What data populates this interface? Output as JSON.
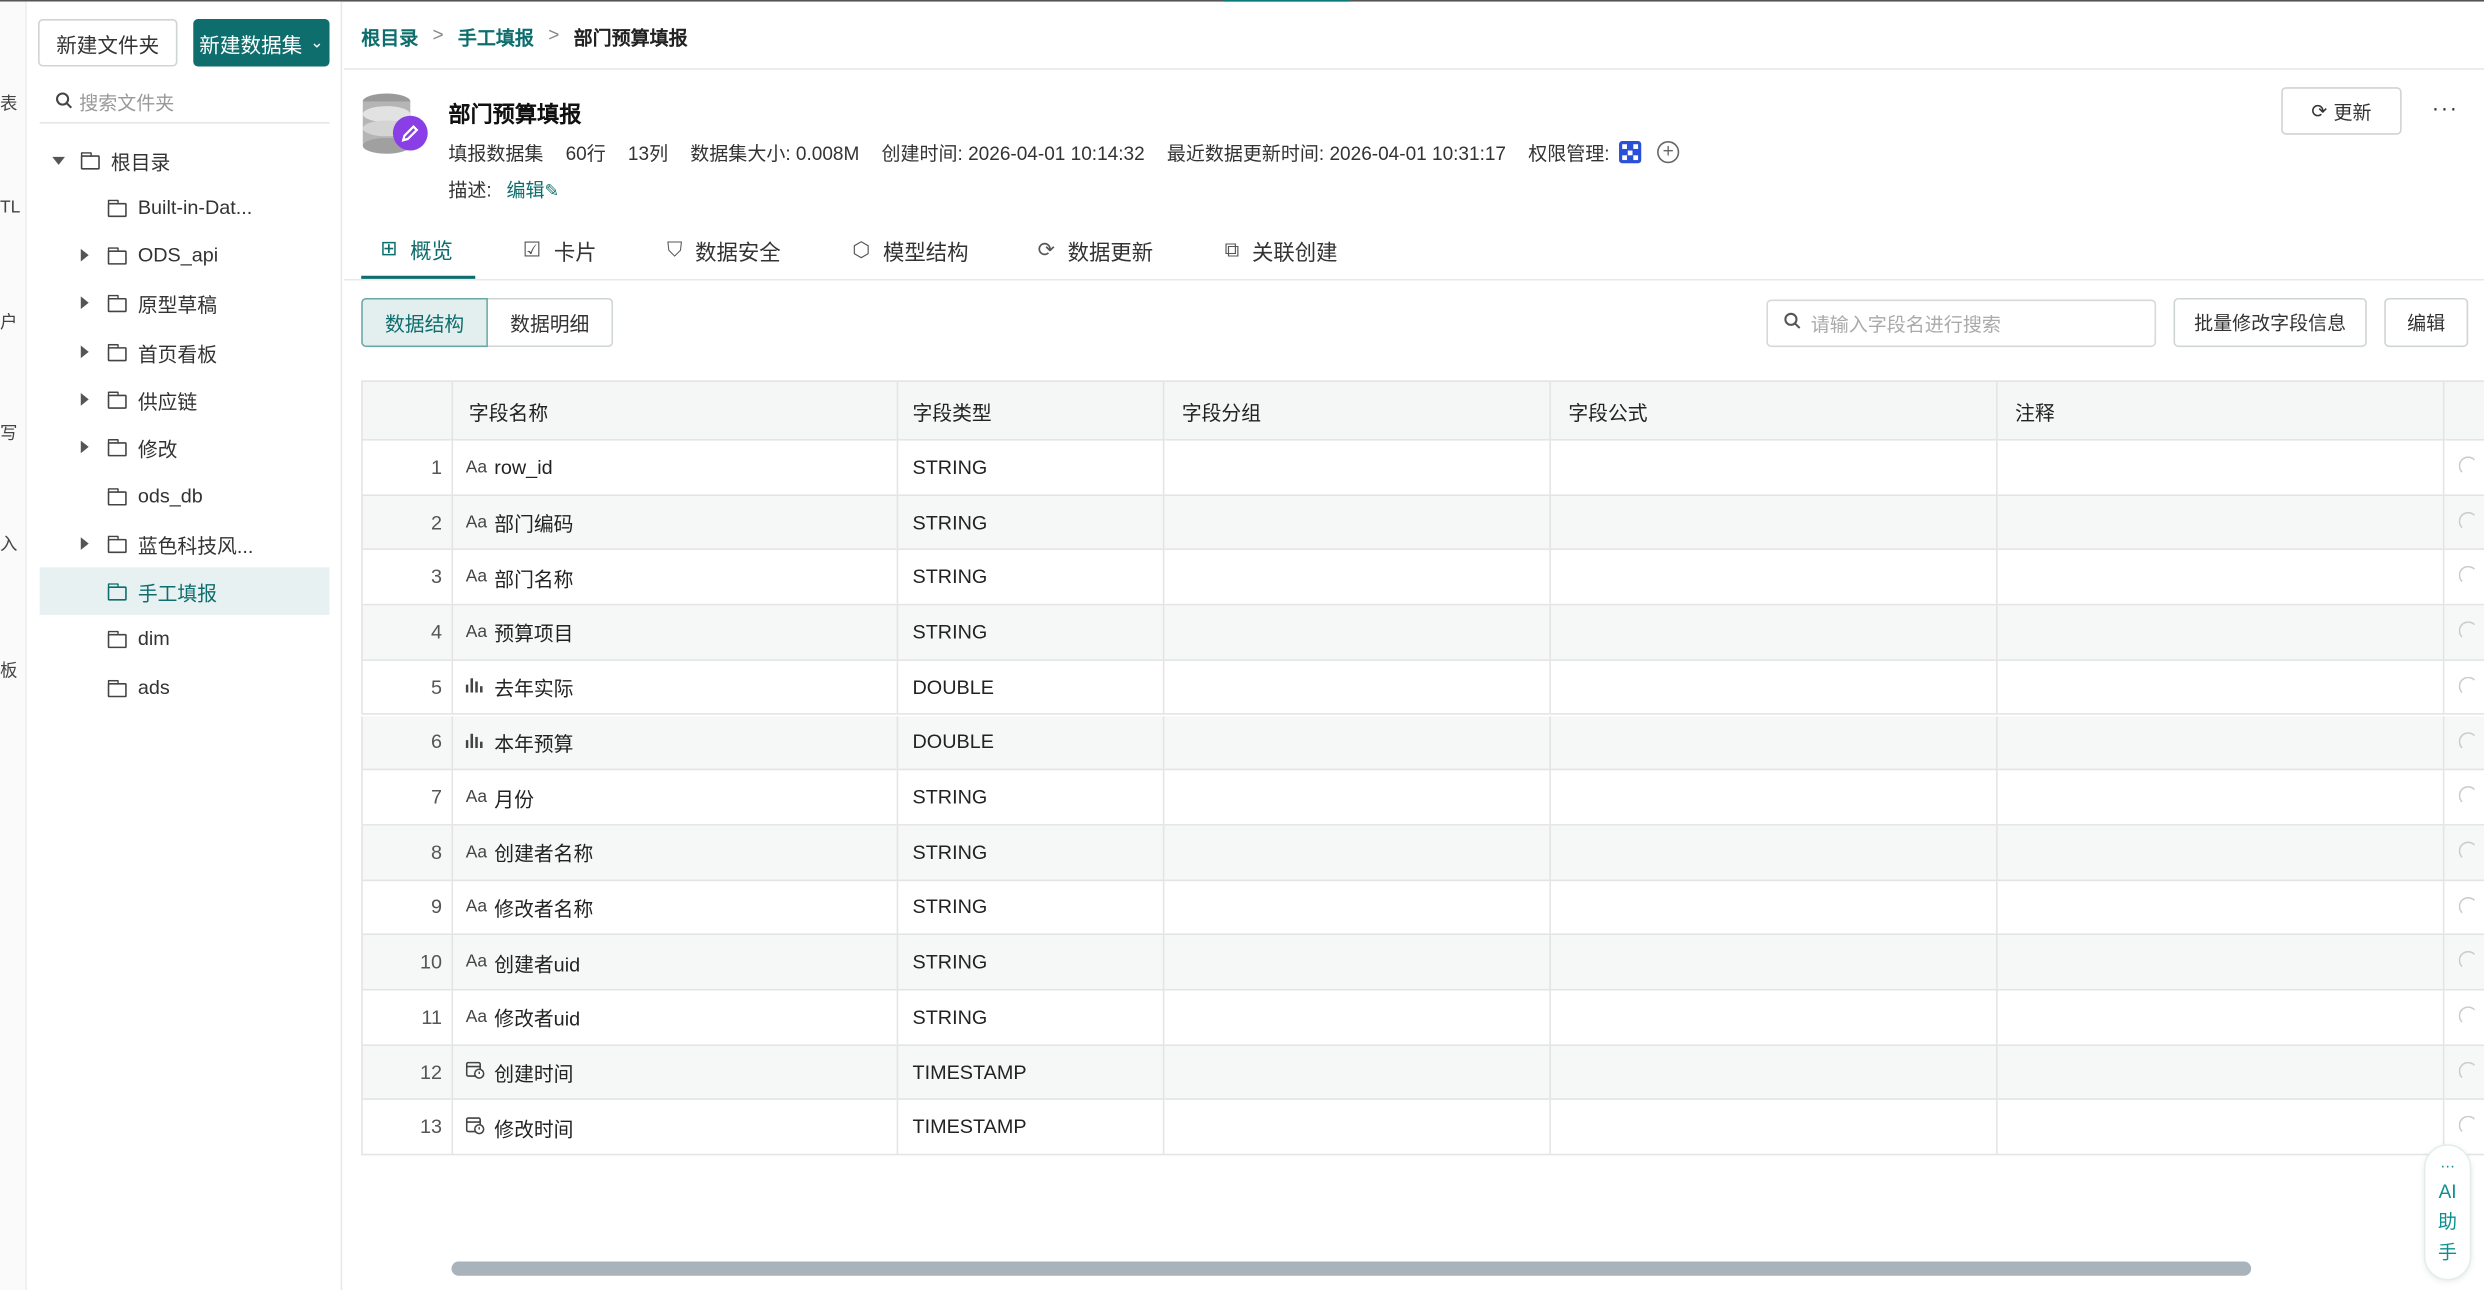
{
  "rail": {
    "glyphs": [
      "表",
      "TL",
      "户",
      "写",
      "入",
      "板"
    ]
  },
  "sidebar": {
    "new_folder": "新建文件夹",
    "new_dataset": "新建数据集",
    "search_placeholder": "搜索文件夹",
    "tree": [
      {
        "label": "根目录",
        "caret": "down",
        "level": 0
      },
      {
        "label": "Built-in-Dat...",
        "caret": "none",
        "level": 1
      },
      {
        "label": "ODS_api",
        "caret": "right",
        "level": 1
      },
      {
        "label": "原型草稿",
        "caret": "right",
        "level": 1
      },
      {
        "label": "首页看板",
        "caret": "right",
        "level": 1
      },
      {
        "label": "供应链",
        "caret": "right",
        "level": 1
      },
      {
        "label": "修改",
        "caret": "right",
        "level": 1
      },
      {
        "label": "ods_db",
        "caret": "none",
        "level": 1
      },
      {
        "label": "蓝色科技风...",
        "caret": "right",
        "level": 1
      },
      {
        "label": "手工填报",
        "caret": "none",
        "level": 1,
        "active": true
      },
      {
        "label": "dim",
        "caret": "none",
        "level": 1
      },
      {
        "label": "ads",
        "caret": "none",
        "level": 1
      }
    ]
  },
  "breadcrumb": [
    "根目录",
    "手工填报",
    "部门预算填报"
  ],
  "dataset": {
    "title": "部门预算填报",
    "type": "填报数据集",
    "rows": "60行",
    "cols": "13列",
    "size": "数据集大小: 0.008M",
    "created": "创建时间:  2026-04-01 10:14:32",
    "updated": "最近数据更新时间:  2026-04-01 10:31:17",
    "perm": "权限管理:",
    "desc_label": "描述:",
    "desc_edit": "编辑"
  },
  "toolbar": {
    "refresh": "更新",
    "more": "···"
  },
  "tabs": [
    {
      "label": "概览",
      "icon": "⊞",
      "active": true
    },
    {
      "label": "卡片",
      "icon": "☑"
    },
    {
      "label": "数据安全",
      "icon": "⛉"
    },
    {
      "label": "模型结构",
      "icon": "⬡"
    },
    {
      "label": "数据更新",
      "icon": "⟳"
    },
    {
      "label": "关联创建",
      "icon": "⧉"
    }
  ],
  "view_toggle": {
    "structure": "数据结构",
    "detail": "数据明细"
  },
  "field_search_placeholder": "请输入字段名进行搜索",
  "batch_edit": "批量修改字段信息",
  "edit": "编辑",
  "table": {
    "headers": [
      "字段名称",
      "字段类型",
      "字段分组",
      "字段公式",
      "注释"
    ],
    "rows": [
      {
        "no": "1",
        "icon": "Aa",
        "name": "row_id",
        "type": "STRING"
      },
      {
        "no": "2",
        "icon": "Aa",
        "name": "部门编码",
        "type": "STRING"
      },
      {
        "no": "3",
        "icon": "Aa",
        "name": "部门名称",
        "type": "STRING"
      },
      {
        "no": "4",
        "icon": "Aa",
        "name": "预算项目",
        "type": "STRING"
      },
      {
        "no": "5",
        "icon": "bar",
        "name": "去年实际",
        "type": "DOUBLE"
      },
      {
        "no": "6",
        "icon": "bar",
        "name": "本年预算",
        "type": "DOUBLE"
      },
      {
        "no": "7",
        "icon": "Aa",
        "name": "月份",
        "type": "STRING"
      },
      {
        "no": "8",
        "icon": "Aa",
        "name": "创建者名称",
        "type": "STRING"
      },
      {
        "no": "9",
        "icon": "Aa",
        "name": "修改者名称",
        "type": "STRING"
      },
      {
        "no": "10",
        "icon": "Aa",
        "name": "创建者uid",
        "type": "STRING"
      },
      {
        "no": "11",
        "icon": "Aa",
        "name": "修改者uid",
        "type": "STRING"
      },
      {
        "no": "12",
        "icon": "date",
        "name": "创建时间",
        "type": "TIMESTAMP"
      },
      {
        "no": "13",
        "icon": "date",
        "name": "修改时间",
        "type": "TIMESTAMP"
      }
    ]
  },
  "ai_assistant": [
    "AI",
    "助",
    "手"
  ],
  "colors": {
    "accent": "#0e6e6e",
    "active_bg": "#e8f1f1"
  }
}
